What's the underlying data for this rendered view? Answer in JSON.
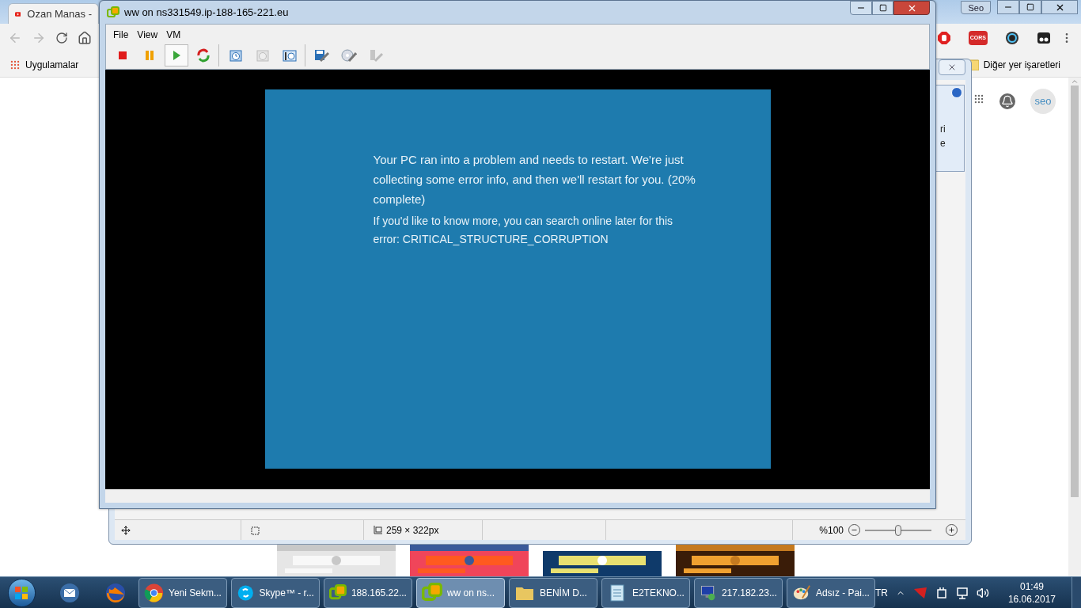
{
  "browser": {
    "tab_title": "Ozan Manas - ",
    "profile": "Seo",
    "cors_badge": "CORS",
    "bookmarks": [
      {
        "label": "Uygulamalar"
      }
    ],
    "other_bookmarks": "Diğer yer işaretleri",
    "avatar_text": "seo"
  },
  "paint": {
    "dialog_text": [
      "ri",
      "e"
    ],
    "status": {
      "size": "259 × 322px",
      "zoom": "%100",
      "level": 0.5
    }
  },
  "vm_window": {
    "title": "ww on ns331549.ip-188-165-221.eu",
    "menu": [
      "File",
      "View",
      "VM"
    ],
    "toolbar": [
      {
        "items": [
          {
            "kind": "stop",
            "selected": false,
            "disabled": false
          },
          {
            "kind": "pause",
            "selected": false,
            "disabled": false
          },
          {
            "kind": "play",
            "selected": true,
            "disabled": false
          },
          {
            "kind": "reset",
            "selected": false,
            "disabled": false
          }
        ]
      },
      {
        "items": [
          {
            "kind": "snapshot",
            "selected": false,
            "disabled": false
          },
          {
            "kind": "revert",
            "selected": false,
            "disabled": true
          },
          {
            "kind": "manage",
            "selected": false,
            "disabled": false
          }
        ]
      },
      {
        "items": [
          {
            "kind": "settings",
            "selected": false,
            "disabled": false
          },
          {
            "kind": "cd",
            "selected": false,
            "disabled": false
          },
          {
            "kind": "usb",
            "selected": false,
            "disabled": true
          }
        ]
      }
    ],
    "bsod": {
      "message": "Your PC ran into a problem and needs to restart. We're just collecting some error info, and then we'll restart for you. (20% complete)",
      "detail": "If you'd like to know more, you can search online later for this error: CRITICAL_STRUCTURE_CORRUPTION"
    }
  },
  "taskbar": {
    "pinned": [
      {
        "kind": "mail"
      },
      {
        "kind": "firefox"
      }
    ],
    "items": [
      {
        "kind": "chrome",
        "label": "Yeni Sekm...",
        "selected": false
      },
      {
        "kind": "skype",
        "label": "Skype™ - r...",
        "selected": false
      },
      {
        "kind": "vm",
        "label": "188.165.22...",
        "selected": false
      },
      {
        "kind": "vm",
        "label": "ww on ns...",
        "selected": true
      },
      {
        "kind": "folder",
        "label": "BENİM D...",
        "selected": false
      },
      {
        "kind": "notepad",
        "label": "E2TEKNO...",
        "selected": false
      },
      {
        "kind": "remote",
        "label": "217.182.23...",
        "selected": false
      },
      {
        "kind": "paint",
        "label": "Adsız - Pai...",
        "selected": false
      }
    ],
    "language": "TR",
    "time": "01:49",
    "date": "16.06.2017"
  }
}
